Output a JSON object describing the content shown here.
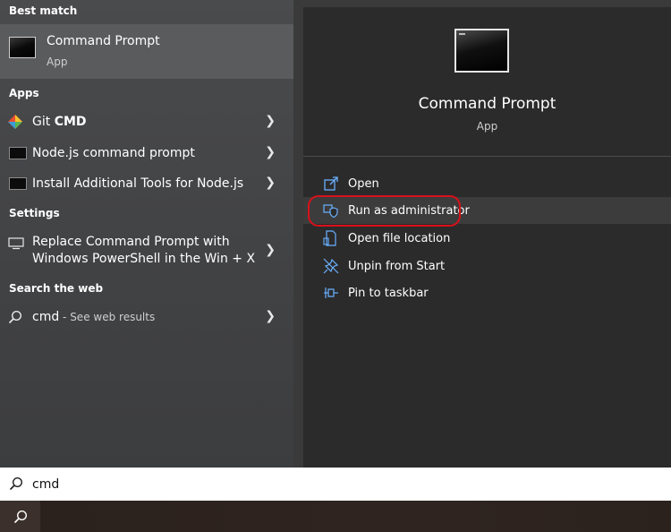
{
  "left": {
    "best_match_header": "Best match",
    "best_match": {
      "title": "Command Prompt",
      "subtitle": "App"
    },
    "apps_header": "Apps",
    "apps": [
      {
        "label_prefix": "Git ",
        "label_bold": "CMD"
      },
      {
        "label": "Node.js command prompt"
      },
      {
        "label": "Install Additional Tools for Node.js"
      }
    ],
    "settings_header": "Settings",
    "settings": [
      {
        "line1": "Replace Command Prompt with",
        "line2": "Windows PowerShell in the Win + X"
      }
    ],
    "web_header": "Search the web",
    "web": {
      "query": "cmd",
      "suffix": " - See web results"
    }
  },
  "right": {
    "title": "Command Prompt",
    "subtitle": "App",
    "actions": [
      {
        "label": "Open",
        "icon": "open-icon"
      },
      {
        "label": "Run as administrator",
        "icon": "shield-icon"
      },
      {
        "label": "Open file location",
        "icon": "file-icon"
      },
      {
        "label": "Unpin from Start",
        "icon": "unpin-icon"
      },
      {
        "label": "Pin to taskbar",
        "icon": "pin-icon"
      }
    ]
  },
  "search": {
    "value": "cmd"
  },
  "colors": {
    "accent": "#6ab0ff",
    "highlight_ring": "#d8101a",
    "search_bg": "#ffffff"
  }
}
